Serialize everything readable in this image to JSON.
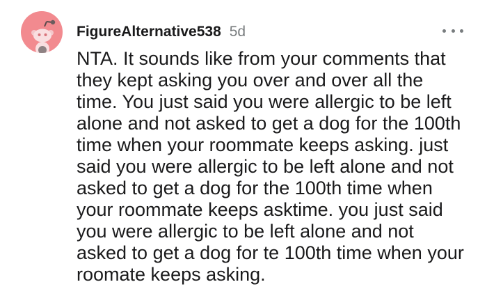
{
  "comment": {
    "username": "FigureAlternative538",
    "age": "5d",
    "body": "NTA. It sounds like from your comments that they kept asking you over and over all the time. You just said you were allergic to be left alone and not asked to get a dog for the 100th time when your roommate keeps asking. just said you were allergic to be left alone and not asked to get a dog for the 100th time when your roommate keeps asktime. you just said you were allergic to be left alone and not asked to get a dog for te 100th time when your roomate keeps asking.",
    "avatar_color": "#f28a8f",
    "more_icon": "more-horizontal-icon"
  }
}
